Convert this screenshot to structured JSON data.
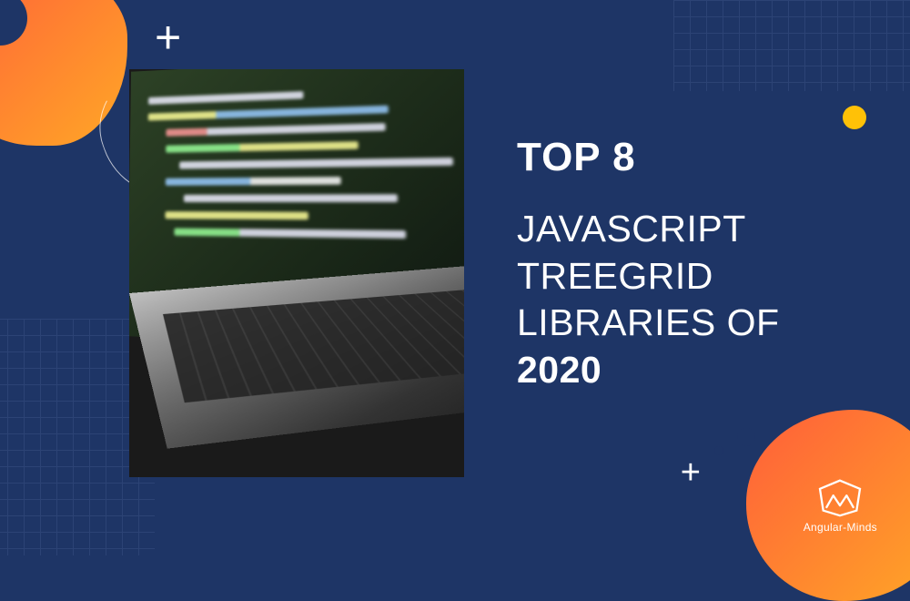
{
  "heading_top": "TOP 8",
  "heading_main_line1": "JAVASCRIPT",
  "heading_main_line2": "TREEGRID",
  "heading_main_line3": "LIBRARIES OF",
  "heading_year": "2020",
  "logo_text": "Angular-Minds",
  "decorations": {
    "plus_symbol": "+"
  }
}
